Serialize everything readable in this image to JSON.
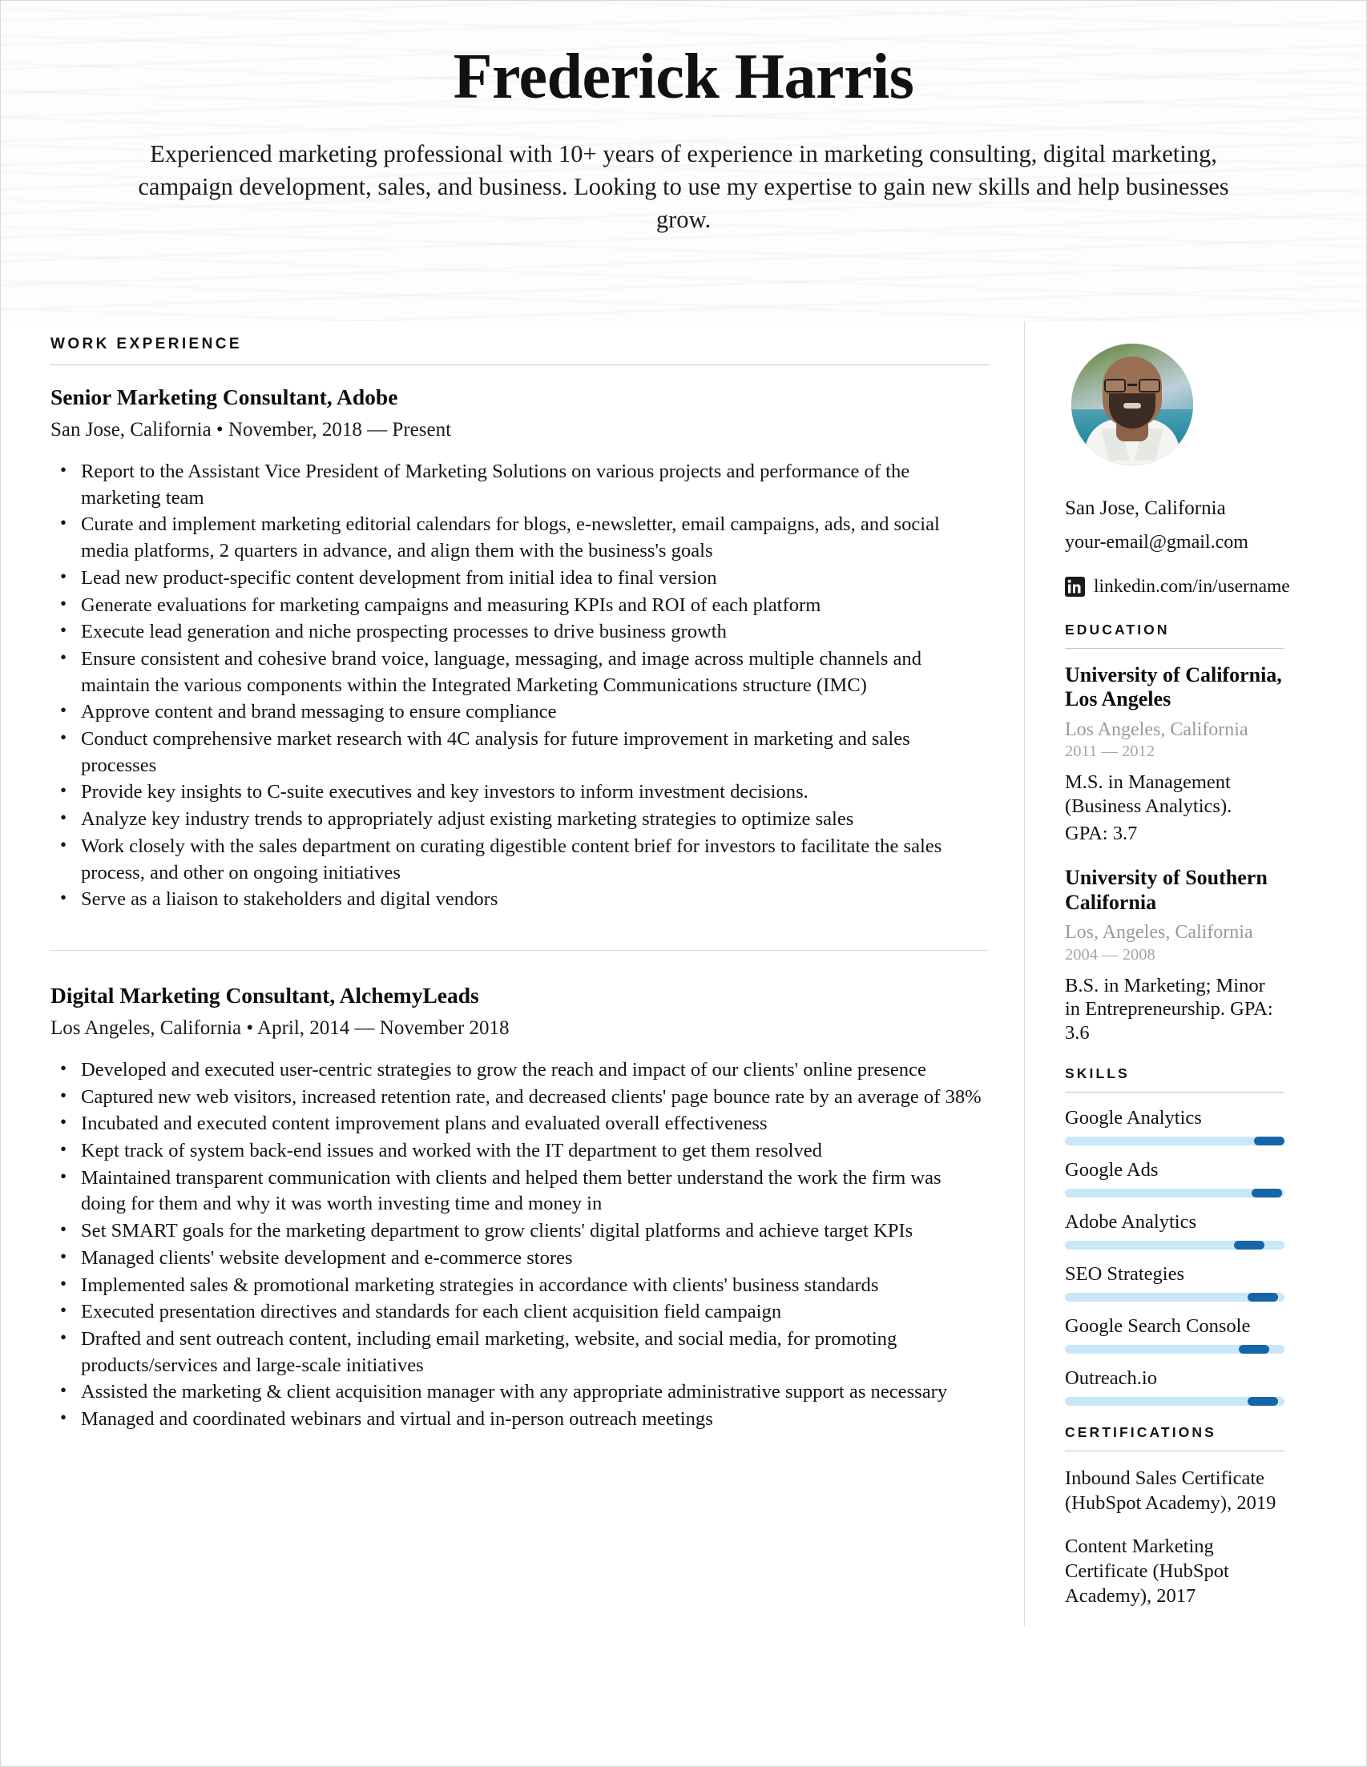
{
  "header": {
    "name": "Frederick Harris",
    "summary": "Experienced marketing professional with 10+ years of experience in marketing consulting, digital marketing, campaign development, sales, and business. Looking to use my expertise to gain new skills and help businesses grow."
  },
  "main": {
    "work_experience_heading": "WORK EXPERIENCE",
    "jobs": [
      {
        "title": "Senior Marketing Consultant, Adobe",
        "meta": "San Jose, California • November, 2018 — Present",
        "bullets": [
          "Report to the Assistant Vice President of Marketing Solutions on various projects and performance of the marketing team",
          "Curate and implement marketing editorial calendars for blogs, e-newsletter, email campaigns, ads, and social media platforms, 2 quarters in advance, and align them with the business's goals",
          "Lead new product-specific content development from initial idea to final version",
          "Generate evaluations for marketing campaigns and measuring KPIs and ROI of each platform",
          "Execute lead generation and niche prospecting processes to drive business growth",
          "Ensure consistent and cohesive brand voice, language, messaging, and image across multiple channels and maintain the various components within the Integrated Marketing Communications structure (IMC)",
          "Approve content and brand messaging to ensure compliance",
          "Conduct comprehensive market research with 4C analysis for future improvement in marketing and sales processes",
          "Provide key insights to C-suite executives and key investors to inform investment decisions.",
          "Analyze key industry trends to appropriately adjust existing marketing strategies to optimize sales",
          "Work closely with the sales department on curating digestible content brief for investors to facilitate the sales process, and other on ongoing initiatives",
          "Serve as a liaison to stakeholders and digital vendors"
        ]
      },
      {
        "title": "Digital Marketing Consultant, AlchemyLeads",
        "meta": "Los Angeles, California • April, 2014 — November 2018",
        "bullets": [
          "Developed and executed user-centric strategies to grow the reach and impact of our clients' online presence",
          "Captured new web visitors, increased retention rate, and decreased clients' page bounce rate by an average of 38%",
          "Incubated and executed content improvement plans and evaluated overall effectiveness",
          "Kept track of system back-end issues and worked with the IT department to get them resolved",
          "Maintained transparent communication with clients and helped them better understand the work the firm was doing for them and why it was worth investing time and money in",
          "Set SMART goals for the marketing department to grow clients' digital platforms and achieve target KPIs",
          "Managed clients' website development and e-commerce stores",
          "Implemented sales & promotional marketing strategies in accordance with clients' business standards",
          "Executed presentation directives and standards for each client acquisition field campaign",
          "Drafted and sent outreach content, including email marketing, website, and social media, for promoting products/services and large-scale initiatives",
          "Assisted the marketing & client acquisition manager with any appropriate administrative support as necessary",
          "Managed and coordinated webinars and virtual and in-person outreach meetings"
        ]
      }
    ]
  },
  "sidebar": {
    "contact": {
      "location": "San Jose, California",
      "email": "your-email@gmail.com",
      "linkedin": "linkedin.com/in/username",
      "linkedin_icon": "linkedin-icon"
    },
    "education_heading": "EDUCATION",
    "education": [
      {
        "school": "University of California, Los Angeles",
        "location": "Los Angeles, California",
        "years": "2011 — 2012",
        "degree": "M.S. in Management (Business Analytics).",
        "gpa": "GPA: 3.7"
      },
      {
        "school": "University of Southern California",
        "location": "Los, Angeles, California",
        "years": "2004 — 2008",
        "degree": "B.S. in Marketing; Minor in Entrepreneurship. GPA: 3.6",
        "gpa": ""
      }
    ],
    "skills_heading": "SKILLS",
    "skills": [
      {
        "name": "Google Analytics",
        "level": 97
      },
      {
        "name": "Google Ads",
        "level": 96
      },
      {
        "name": "Adobe Analytics",
        "level": 88
      },
      {
        "name": "SEO Strategies",
        "level": 94
      },
      {
        "name": "Google Search Console",
        "level": 90
      },
      {
        "name": "Outreach.io",
        "level": 94
      }
    ],
    "certifications_heading": "CERTIFICATIONS",
    "certifications": [
      "Inbound Sales Certificate (HubSpot Academy), 2019",
      "Content Marketing Certificate (HubSpot Academy), 2017"
    ]
  },
  "colors": {
    "skill_track": "#c9e7f7",
    "skill_knob": "#1565a8",
    "rule": "#c6c6c6",
    "muted_text": "#9a9a9a"
  }
}
